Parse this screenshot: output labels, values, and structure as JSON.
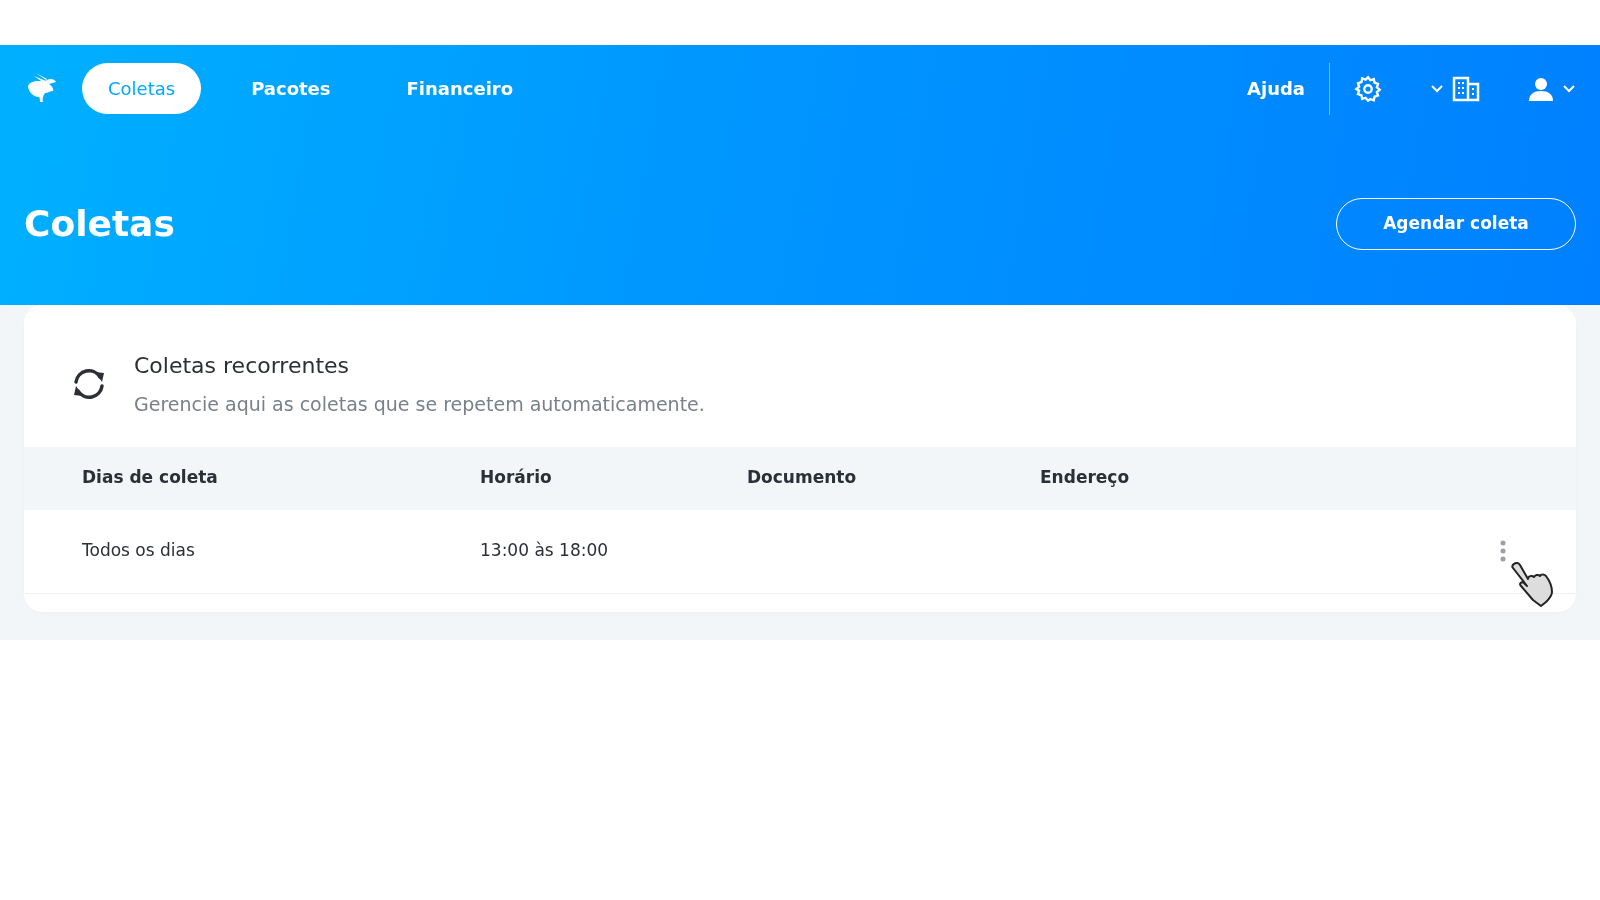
{
  "nav": {
    "tabs": [
      {
        "label": "Coletas",
        "selected": true
      },
      {
        "label": "Pacotes",
        "selected": false
      },
      {
        "label": "Financeiro",
        "selected": false
      }
    ],
    "help": "Ajuda"
  },
  "page": {
    "title": "Coletas",
    "action": "Agendar coleta"
  },
  "section": {
    "title": "Coletas recorrentes",
    "subtitle": "Gerencie aqui as coletas que se repetem automaticamente."
  },
  "table": {
    "columns": [
      "Dias de coleta",
      "Horário",
      "Documento",
      "Endereço"
    ],
    "rows": [
      {
        "cells": [
          "Todos os dias",
          "13:00 às 18:00",
          "",
          ""
        ]
      }
    ]
  }
}
